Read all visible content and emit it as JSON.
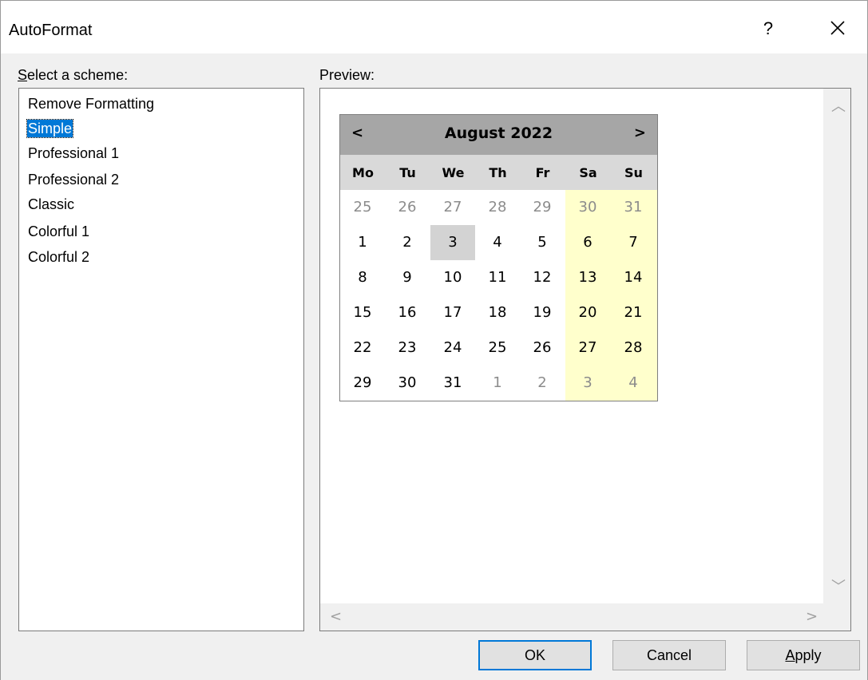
{
  "window": {
    "title": "AutoFormat",
    "help": "?",
    "close_icon": "close-icon"
  },
  "scheme_label": {
    "prefix": "S",
    "rest": "elect a scheme:"
  },
  "preview_label": "Preview:",
  "schemes": [
    {
      "label": "Remove Formatting"
    },
    {
      "label": "Simple",
      "selected": true
    },
    {
      "label": "Professional 1"
    },
    {
      "label": "Professional 2"
    },
    {
      "label": "Classic"
    },
    {
      "label": "Colorful 1"
    },
    {
      "label": "Colorful 2"
    }
  ],
  "calendar": {
    "prev": "<",
    "next": ">",
    "title": "August 2022",
    "days_of_week": [
      "Mo",
      "Tu",
      "We",
      "Th",
      "Fr",
      "Sa",
      "Su"
    ],
    "weeks": [
      [
        "25",
        "26",
        "27",
        "28",
        "29",
        "30",
        "31"
      ],
      [
        "1",
        "2",
        "3",
        "4",
        "5",
        "6",
        "7"
      ],
      [
        "8",
        "9",
        "10",
        "11",
        "12",
        "13",
        "14"
      ],
      [
        "15",
        "16",
        "17",
        "18",
        "19",
        "20",
        "21"
      ],
      [
        "22",
        "23",
        "24",
        "25",
        "26",
        "27",
        "28"
      ],
      [
        "29",
        "30",
        "31",
        "1",
        "2",
        "3",
        "4"
      ]
    ],
    "today": "3"
  },
  "buttons": {
    "ok": "OK",
    "cancel": "Cancel",
    "apply_prefix": "A",
    "apply_rest": "pply"
  },
  "colors": {
    "selection": "#0078d7",
    "header": "#a6a6a6",
    "dow_row": "#d9d9d9",
    "weekend": "#ffffcc",
    "today": "#d3d3d3"
  }
}
